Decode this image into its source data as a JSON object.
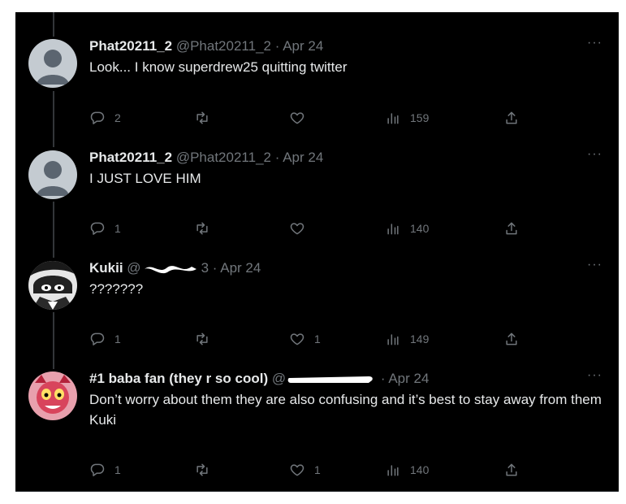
{
  "colors": {
    "background": "#000000",
    "text_primary": "#e7e9ea",
    "text_secondary": "#71767b",
    "thread_line": "#333639"
  },
  "icons": {
    "reply": "reply-icon",
    "retweet": "retweet-icon",
    "like": "heart-icon",
    "views": "views-icon",
    "share": "share-icon",
    "more": "more-icon"
  },
  "tweets": [
    {
      "name": "Phat20211_2",
      "handle": "@Phat20211_2",
      "sep": "·",
      "date": "Apr 24",
      "text": "Look... I know superdrew25 quitting twitter",
      "replies": "2",
      "retweets": "",
      "likes": "",
      "views": "159",
      "more": "···"
    },
    {
      "name": "Phat20211_2",
      "handle": "@Phat20211_2",
      "sep": "·",
      "date": "Apr 24",
      "text": "I JUST LOVE HIM",
      "replies": "1",
      "retweets": "",
      "likes": "",
      "views": "140",
      "more": "···"
    },
    {
      "name": "Kukii",
      "handle": "@",
      "handle_tail": "3",
      "sep": "·",
      "date": "Apr 24",
      "text": "???????",
      "replies": "1",
      "retweets": "",
      "likes": "1",
      "views": "149",
      "more": "···"
    },
    {
      "name": "#1 baba fan (they r so cool)",
      "handle": "@",
      "handle_tail": "",
      "sep": "·",
      "date": "Apr 24",
      "text": "Don’t worry about them they are also confusing and it’s best to stay away from them Kuki",
      "replies": "1",
      "retweets": "",
      "likes": "1",
      "views": "140",
      "more": "···"
    }
  ]
}
